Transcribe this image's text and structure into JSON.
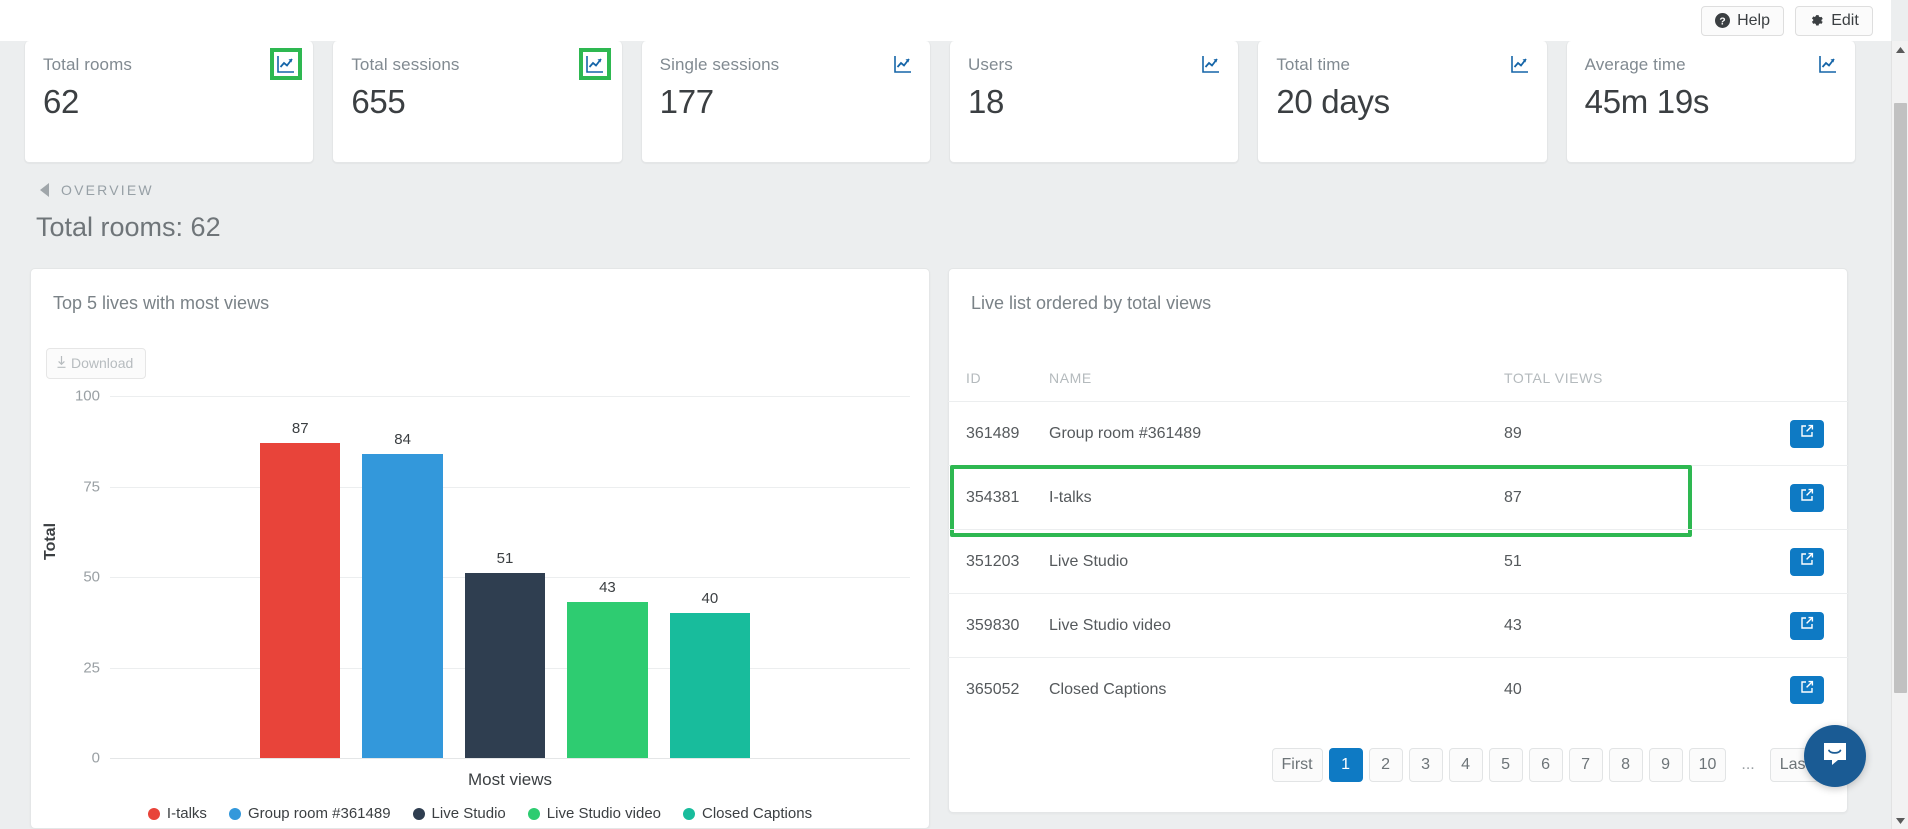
{
  "topbar": {
    "help_label": "Help",
    "edit_label": "Edit",
    "help_icon": "question-circle-icon",
    "edit_icon": "gear-icon"
  },
  "cards": [
    {
      "label": "Total rooms",
      "value": "62",
      "icon": "line-chart-icon",
      "highlighted": true
    },
    {
      "label": "Total sessions",
      "value": "655",
      "icon": "line-chart-icon",
      "highlighted": true
    },
    {
      "label": "Single sessions",
      "value": "177",
      "icon": "line-chart-icon",
      "highlighted": false
    },
    {
      "label": "Users",
      "value": "18",
      "icon": "line-chart-icon",
      "highlighted": false
    },
    {
      "label": "Total time",
      "value": "20 days",
      "icon": "line-chart-icon",
      "highlighted": false
    },
    {
      "label": "Average time",
      "value": "45m 19s",
      "icon": "line-chart-icon",
      "highlighted": false
    }
  ],
  "overview": {
    "breadcrumb": "OVERVIEW",
    "page_title": "Total rooms: 62"
  },
  "chart_panel": {
    "title": "Top 5 lives with most views",
    "download_label": "Download",
    "download_icon": "download-arrow-icon"
  },
  "chart_data": {
    "type": "bar",
    "title": "Top 5 lives with most views",
    "categories": [
      "I-talks",
      "Group room #361489",
      "Live Studio",
      "Live Studio video",
      "Closed Captions"
    ],
    "values": [
      87,
      84,
      51,
      43,
      40
    ],
    "colors": [
      "#e8443a",
      "#3398db",
      "#2f3e50",
      "#2ecc71",
      "#18bc9c"
    ],
    "xlabel": "Most views",
    "ylabel": "Total",
    "ylim": [
      0,
      100
    ],
    "yticks": [
      0,
      25,
      50,
      75,
      100
    ],
    "grid": true,
    "legend_position": "bottom",
    "data_labels": true
  },
  "list_panel": {
    "title": "Live list ordered by total views",
    "columns": [
      "ID",
      "NAME",
      "TOTAL VIEWS",
      ""
    ],
    "rows": [
      {
        "id": "361489",
        "name": "Group room #361489",
        "views": "89",
        "action_icon": "external-link-icon",
        "highlighted": false
      },
      {
        "id": "354381",
        "name": "I-talks",
        "views": "87",
        "action_icon": "external-link-icon",
        "highlighted": true
      },
      {
        "id": "351203",
        "name": "Live Studio",
        "views": "51",
        "action_icon": "external-link-icon",
        "highlighted": false
      },
      {
        "id": "359830",
        "name": "Live Studio video",
        "views": "43",
        "action_icon": "external-link-icon",
        "highlighted": false
      },
      {
        "id": "365052",
        "name": "Closed Captions",
        "views": "40",
        "action_icon": "external-link-icon",
        "highlighted": false
      }
    ]
  },
  "pagination": {
    "items": [
      {
        "label": "First",
        "active": false,
        "dots": false
      },
      {
        "label": "1",
        "active": true,
        "dots": false
      },
      {
        "label": "2",
        "active": false,
        "dots": false
      },
      {
        "label": "3",
        "active": false,
        "dots": false
      },
      {
        "label": "4",
        "active": false,
        "dots": false
      },
      {
        "label": "5",
        "active": false,
        "dots": false
      },
      {
        "label": "6",
        "active": false,
        "dots": false
      },
      {
        "label": "7",
        "active": false,
        "dots": false
      },
      {
        "label": "8",
        "active": false,
        "dots": false
      },
      {
        "label": "9",
        "active": false,
        "dots": false
      },
      {
        "label": "10",
        "active": false,
        "dots": false
      },
      {
        "label": "...",
        "active": false,
        "dots": true
      },
      {
        "label": "Last",
        "active": false,
        "dots": false
      }
    ]
  },
  "chat": {
    "icon": "intercom-chat-icon"
  },
  "colors": {
    "accent_blue": "#0e7ac4",
    "highlight_green": "#2eb851",
    "page_background": "#eceeef"
  }
}
